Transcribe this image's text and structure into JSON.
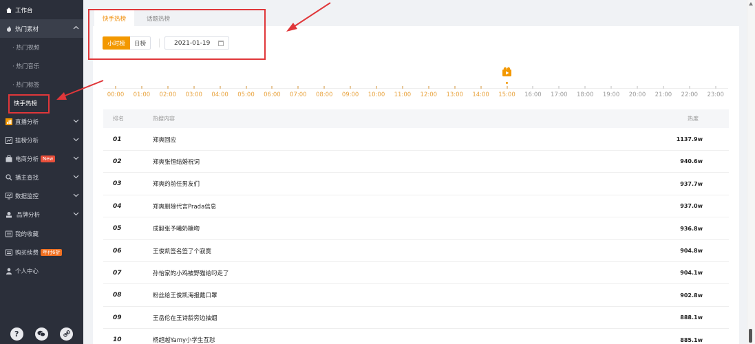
{
  "sidebar": {
    "workbench": "工作台",
    "hot_material": "热门素材",
    "sub_items": [
      "· 热门视频",
      "· 热门音乐",
      "· 热门标签",
      "快手热榜"
    ],
    "groups": [
      {
        "label": "直播分析",
        "icon": "bar-chart-icon"
      },
      {
        "label": "挂榜分析",
        "icon": "line-chart-icon"
      },
      {
        "label": "电商分析",
        "icon": "briefcase-icon",
        "tag": "New"
      },
      {
        "label": "播主查找",
        "icon": "search-icon"
      },
      {
        "label": "数据监控",
        "icon": "monitor-icon"
      },
      {
        "label": "品牌分析",
        "icon": "brand-icon"
      }
    ],
    "favorites": "我的收藏",
    "purchase": "购买续费",
    "purchase_tag": "年付6折",
    "profile": "个人中心"
  },
  "tabs": {
    "active": "快手热榜",
    "inactive": "话题热榜"
  },
  "filters": {
    "hourly": "小时榜",
    "daily": "日榜",
    "date": "2021-01-19"
  },
  "timeline": {
    "hours": [
      "00:00",
      "01:00",
      "02:00",
      "03:00",
      "04:00",
      "05:00",
      "06:00",
      "07:00",
      "08:00",
      "09:00",
      "10:00",
      "11:00",
      "12:00",
      "13:00",
      "14:00",
      "15:00",
      "16:00",
      "17:00",
      "18:00",
      "19:00",
      "20:00",
      "21:00",
      "22:00",
      "23:00"
    ],
    "selected": "15:00"
  },
  "table": {
    "headers": {
      "rank": "排名",
      "title": "热搜内容",
      "heat": "热度"
    },
    "rows": [
      {
        "rank": "01",
        "title": "郑爽回应",
        "heat": "1137.9w"
      },
      {
        "rank": "02",
        "title": "郑爽张恒结婚祝词",
        "heat": "940.6w"
      },
      {
        "rank": "03",
        "title": "郑爽的前任男友们",
        "heat": "937.7w"
      },
      {
        "rank": "04",
        "title": "郑爽删除代言Prada信息",
        "heat": "937.0w"
      },
      {
        "rank": "05",
        "title": "成毅张予曦奶糖吻",
        "heat": "936.8w"
      },
      {
        "rank": "06",
        "title": "王俊凯签名签了个寂寞",
        "heat": "904.8w"
      },
      {
        "rank": "07",
        "title": "孙怡家的小鸡被野猫给叼走了",
        "heat": "904.1w"
      },
      {
        "rank": "08",
        "title": "粉丝给王俊凯海报戴口罩",
        "heat": "902.8w"
      },
      {
        "rank": "09",
        "title": "王岳伦在王诗龄旁边抽烟",
        "heat": "888.1w"
      },
      {
        "rank": "10",
        "title": "杨超越Yamy小学生互怼",
        "heat": "885.1w"
      }
    ]
  },
  "colors": {
    "sidebar_bg": "#2b2f3a",
    "accent": "#f39800",
    "annotation_red": "#e0373a"
  }
}
